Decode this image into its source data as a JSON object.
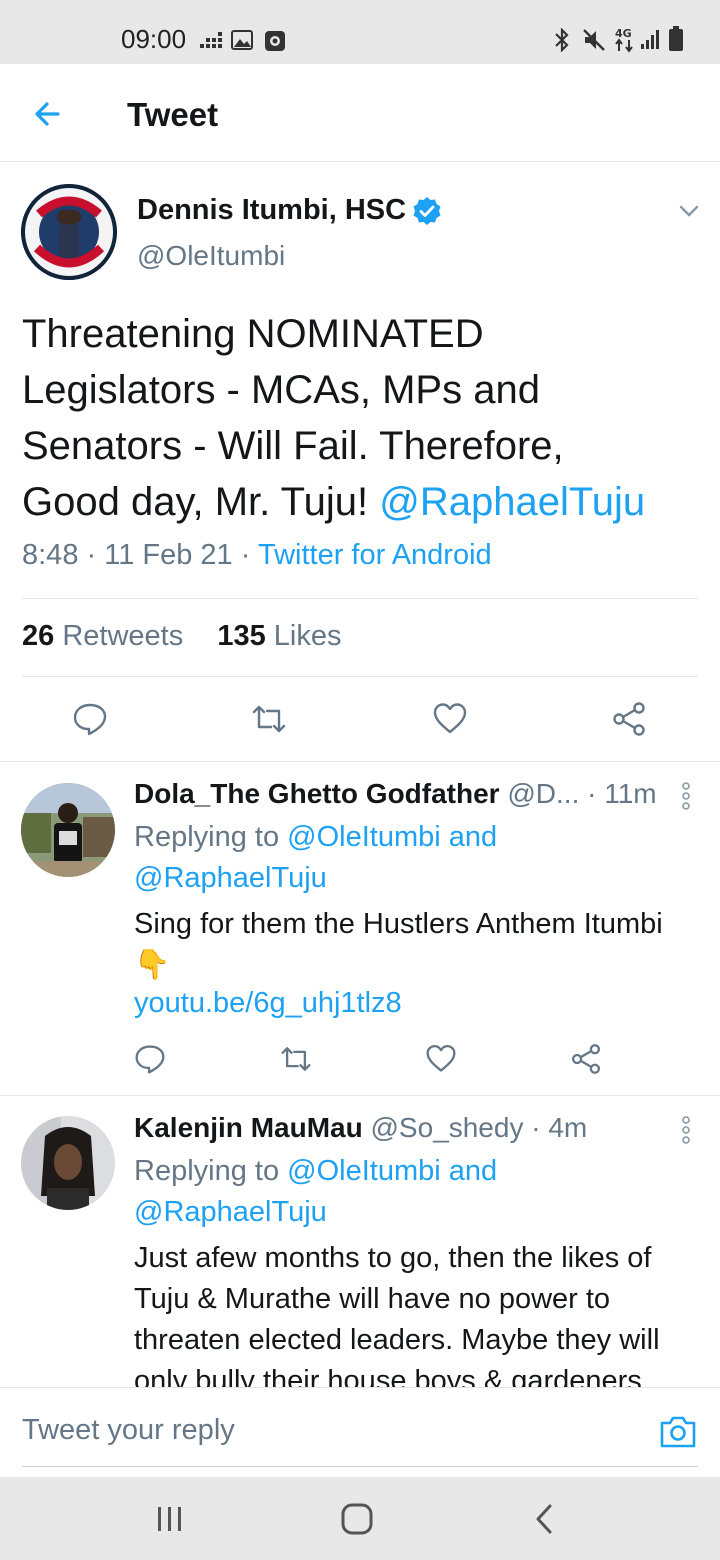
{
  "status_bar": {
    "time": "09:00"
  },
  "header": {
    "title": "Tweet"
  },
  "main_tweet": {
    "author_name": "Dennis Itumbi, HSC",
    "handle": "@OleItumbi",
    "text_line1": "Threatening NOMINATED",
    "text_line2": "Legislators - MCAs, MPs and",
    "text_line3": "Senators - Will Fail. Therefore,",
    "text_line4": "Good day, Mr. Tuju! ",
    "mention": "@RaphaelTuju",
    "time": "8:48",
    "date": "11 Feb 21",
    "source": "Twitter for Android",
    "retweets_count": "26",
    "retweets_label": "Retweets",
    "likes_count": "135",
    "likes_label": "Likes"
  },
  "replies": [
    {
      "name": "Dola_The Ghetto Godfather",
      "handle": "@D...",
      "time": "11m",
      "replying_prefix": "Replying to ",
      "replying_line1": "@OleItumbi and",
      "replying_line2": "@RaphaelTuju",
      "text": "Sing for them the Hustlers Anthem Itumbi",
      "emoji": "👇",
      "link": "youtu.be/6g_uhj1tlz8"
    },
    {
      "name": "Kalenjin MauMau",
      "handle": "@So_shedy",
      "time": "4m",
      "replying_prefix": "Replying to ",
      "replying_line1": "@OleItumbi and",
      "replying_line2": "@RaphaelTuju",
      "text_line1": "Just afew months to go, then the likes of",
      "text_line2": "Tuju & Murathe will have no power to",
      "text_line3": "threaten elected leaders. Maybe they will",
      "text_line4": "only bully  their house boys & gardeners"
    }
  ],
  "reply_bar": {
    "placeholder": "Tweet your reply"
  },
  "colors": {
    "accent": "#1da1f2",
    "muted": "#657786",
    "text": "#14171a"
  },
  "icons": [
    "back-arrow-icon",
    "verified-icon",
    "chevron-down-icon",
    "reply-icon",
    "retweet-icon",
    "like-icon",
    "share-icon",
    "more-vertical-icon",
    "camera-icon"
  ]
}
